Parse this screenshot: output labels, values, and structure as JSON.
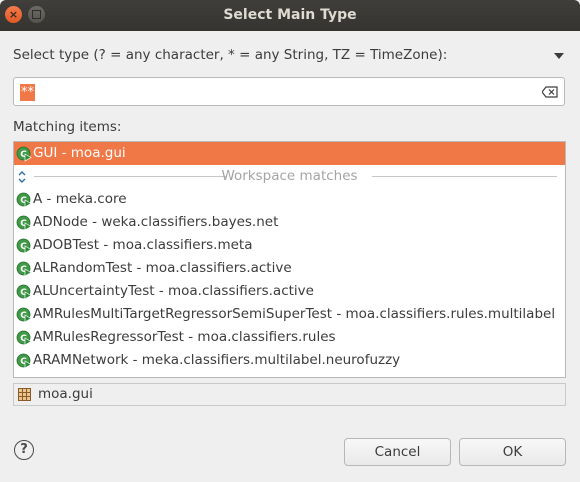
{
  "window": {
    "title": "Select Main Type"
  },
  "prompt": {
    "label": "Select type (? = any character, * = any String, TZ = TimeZone):"
  },
  "filter": {
    "value": "**"
  },
  "list": {
    "label": "Matching items:",
    "history_item": {
      "name": "GUI - moa.gui",
      "selected": true
    },
    "separator": "Workspace matches",
    "items": [
      {
        "name": "A - meka.core"
      },
      {
        "name": "ADNode - weka.classifiers.bayes.net"
      },
      {
        "name": "ADOBTest - moa.classifiers.meta"
      },
      {
        "name": "ALRandomTest - moa.classifiers.active"
      },
      {
        "name": "ALUncertaintyTest - moa.classifiers.active"
      },
      {
        "name": "AMRulesMultiTargetRegressorSemiSuperTest - moa.classifiers.rules.multilabel"
      },
      {
        "name": "AMRulesRegressorTest - moa.classifiers.rules"
      },
      {
        "name": "ARAMNetwork - meka.classifiers.multilabel.neurofuzzy"
      }
    ]
  },
  "status": {
    "package": "moa.gui"
  },
  "buttons": {
    "cancel": "Cancel",
    "ok": "OK",
    "help": "?"
  },
  "icons": {
    "class": "class-with-main-icon",
    "package": "package-icon",
    "menu": "view-menu-icon",
    "clear": "clear-input-icon",
    "separator": "collapse-expand-icon"
  },
  "colors": {
    "accent": "#f07746",
    "titlebar": "#3b3a36"
  }
}
